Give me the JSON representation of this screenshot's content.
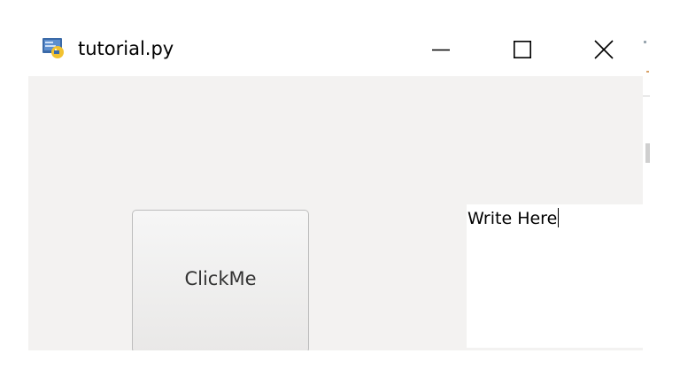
{
  "window": {
    "title": "tutorial.py",
    "icon": "python-file-icon"
  },
  "controls": {
    "minimize_icon": "minimize-icon",
    "maximize_icon": "maximize-icon",
    "close_icon": "close-icon"
  },
  "content": {
    "button_label": "ClickMe",
    "text_value": "Write Here"
  },
  "colors": {
    "client_background": "#f3f2f1",
    "titlebar_background": "#ffffff",
    "text_area_background": "#ffffff"
  }
}
